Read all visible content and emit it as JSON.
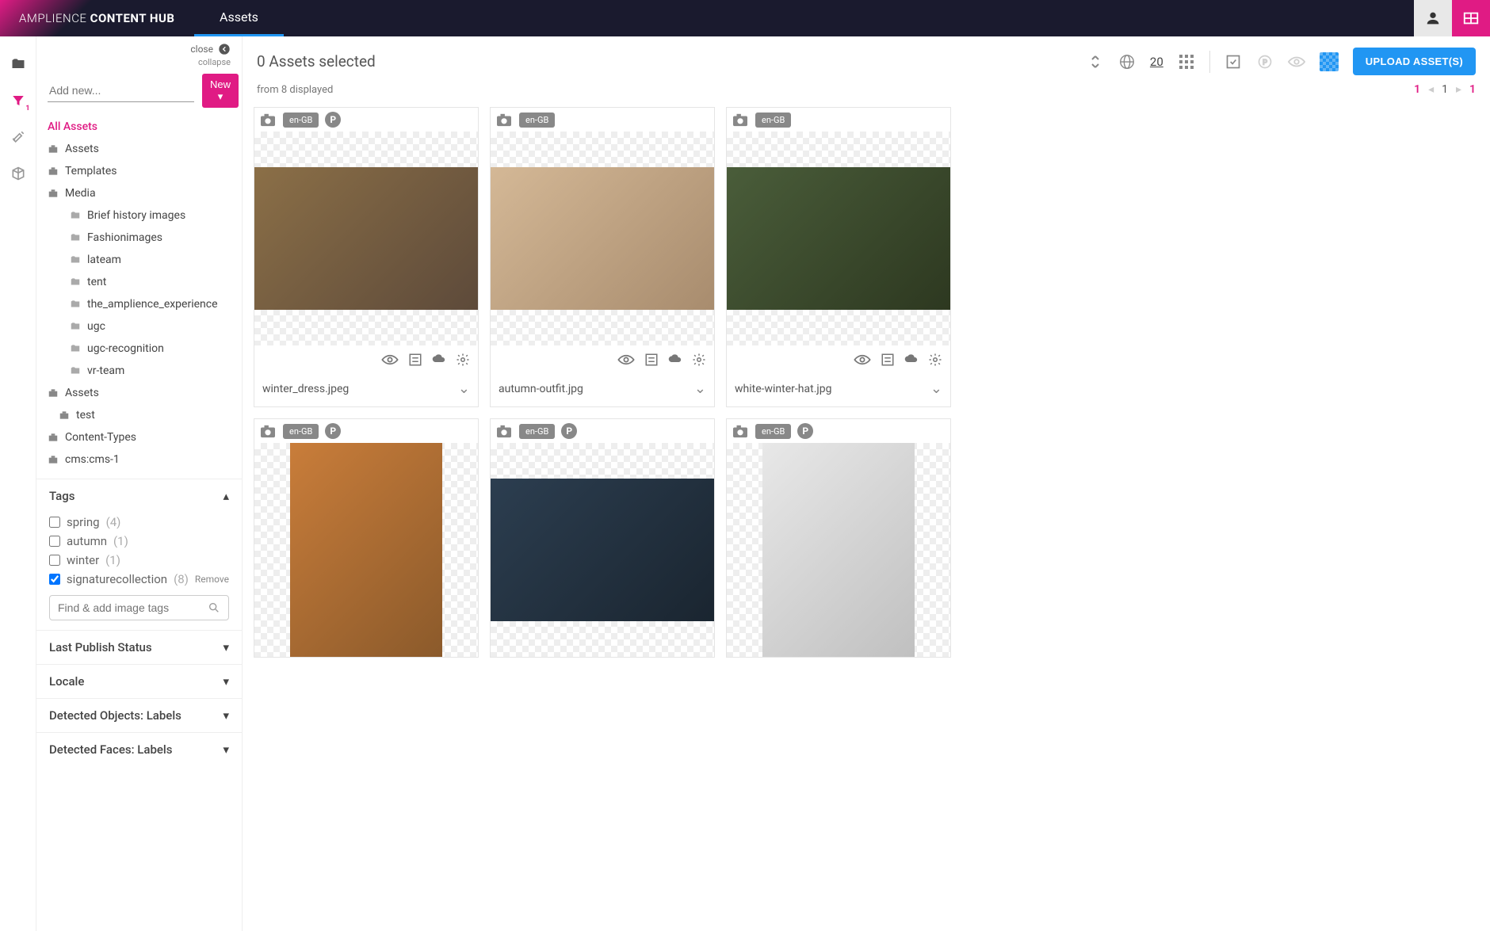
{
  "header": {
    "brand_light": "AMPLIENCE ",
    "brand_bold": "CONTENT HUB",
    "tab": "Assets"
  },
  "sidebar": {
    "close": "close",
    "collapse": "collapse",
    "add_placeholder": "Add new...",
    "new_btn": "New ▾",
    "nav": {
      "all": "All Assets",
      "assets": "Assets",
      "templates": "Templates",
      "media": "Media",
      "media_children": [
        "Brief history images",
        "Fashionimages",
        "lateam",
        "tent",
        "the_amplience_experience",
        "ugc",
        "ugc-recognition",
        "vr-team"
      ],
      "assets2": "Assets",
      "test": "test",
      "content_types": "Content-Types",
      "cms": "cms:cms-1"
    },
    "tags": {
      "title": "Tags",
      "items": [
        {
          "label": "spring",
          "count": "(4)",
          "checked": false
        },
        {
          "label": "autumn",
          "count": "(1)",
          "checked": false
        },
        {
          "label": "winter",
          "count": "(1)",
          "checked": false
        },
        {
          "label": "signaturecollection",
          "count": "(8)",
          "checked": true
        }
      ],
      "remove": "Remove",
      "search_placeholder": "Find & add image tags"
    },
    "sections": [
      "Last Publish Status",
      "Locale",
      "Detected Objects: Labels",
      "Detected Faces: Labels"
    ]
  },
  "content": {
    "selected": "0 Assets selected",
    "displayed": "from 8 displayed",
    "page_size": "20",
    "upload": "UPLOAD ASSET(S)",
    "pager": {
      "first": "1",
      "mid": "1",
      "last": "1"
    },
    "cards": [
      {
        "locale": "en-GB",
        "p": true,
        "name": "winter_dress.jpeg",
        "photo": "photo-1"
      },
      {
        "locale": "en-GB",
        "p": false,
        "name": "autumn-outfit.jpg",
        "photo": "photo-2"
      },
      {
        "locale": "en-GB",
        "p": false,
        "name": "white-winter-hat.jpg",
        "photo": "photo-3"
      },
      {
        "locale": "en-GB",
        "p": true,
        "name": "",
        "photo": "photo-4"
      },
      {
        "locale": "en-GB",
        "p": true,
        "name": "",
        "photo": "photo-5"
      },
      {
        "locale": "en-GB",
        "p": true,
        "name": "",
        "photo": "photo-6"
      }
    ]
  }
}
